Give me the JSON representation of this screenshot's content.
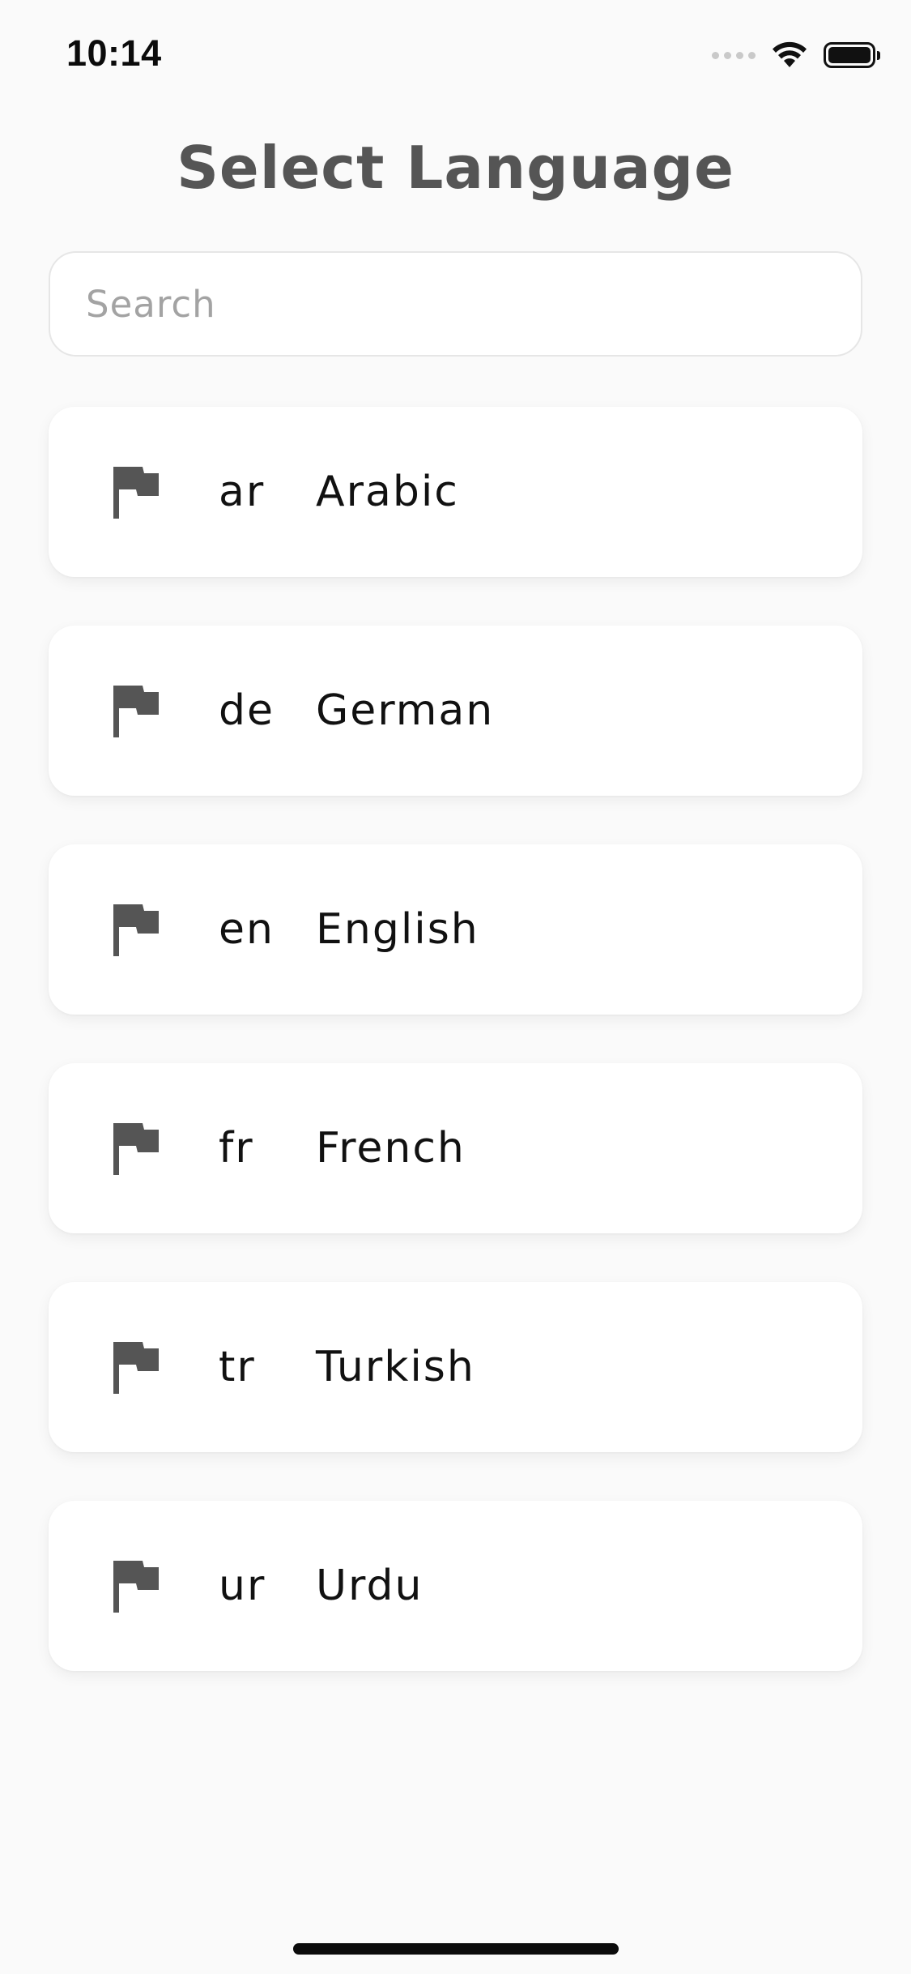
{
  "status_bar": {
    "time": "10:14",
    "icons": [
      "signal-icon",
      "wifi-icon",
      "battery-icon"
    ]
  },
  "page": {
    "title": "Select Language"
  },
  "search": {
    "placeholder": "Search",
    "value": ""
  },
  "languages": [
    {
      "code": "ar",
      "name": "Arabic",
      "icon": "flag-icon"
    },
    {
      "code": "de",
      "name": "German",
      "icon": "flag-icon"
    },
    {
      "code": "en",
      "name": "English",
      "icon": "flag-icon"
    },
    {
      "code": "fr",
      "name": "French",
      "icon": "flag-icon"
    },
    {
      "code": "tr",
      "name": "Turkish",
      "icon": "flag-icon"
    },
    {
      "code": "ur",
      "name": "Urdu",
      "icon": "flag-icon"
    }
  ],
  "colors": {
    "background": "#fafafa",
    "card": "#ffffff",
    "title": "#555555",
    "icon": "#555555",
    "text": "#111111",
    "placeholder": "#a3a3a3"
  }
}
